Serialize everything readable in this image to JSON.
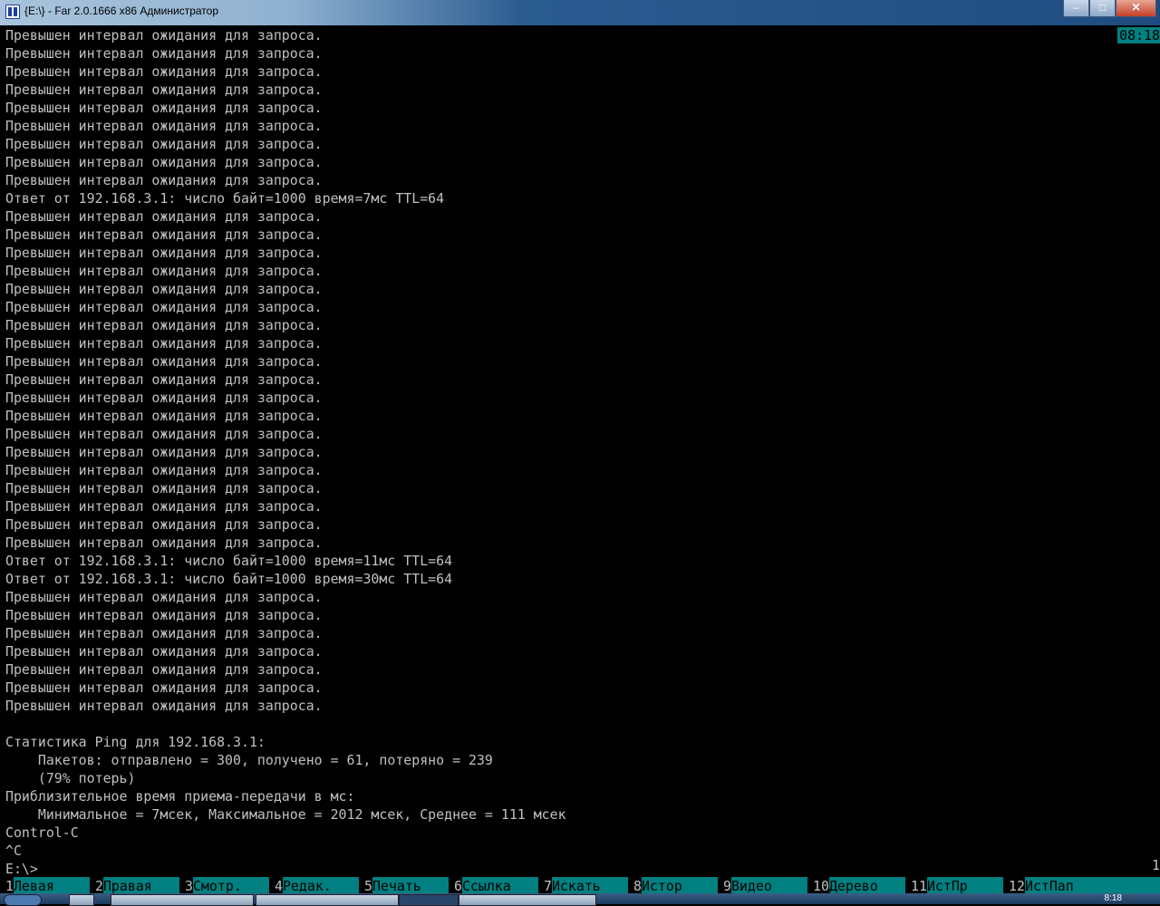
{
  "window": {
    "title": "{E:\\} - Far 2.0.1666 x86 Администратор"
  },
  "clock": "08:18",
  "console_lines": [
    "Превышен интервал ожидания для запроса.",
    "Превышен интервал ожидания для запроса.",
    "Превышен интервал ожидания для запроса.",
    "Превышен интервал ожидания для запроса.",
    "Превышен интервал ожидания для запроса.",
    "Превышен интервал ожидания для запроса.",
    "Превышен интервал ожидания для запроса.",
    "Превышен интервал ожидания для запроса.",
    "Превышен интервал ожидания для запроса.",
    "Ответ от 192.168.3.1: число байт=1000 время=7мс TTL=64",
    "Превышен интервал ожидания для запроса.",
    "Превышен интервал ожидания для запроса.",
    "Превышен интервал ожидания для запроса.",
    "Превышен интервал ожидания для запроса.",
    "Превышен интервал ожидания для запроса.",
    "Превышен интервал ожидания для запроса.",
    "Превышен интервал ожидания для запроса.",
    "Превышен интервал ожидания для запроса.",
    "Превышен интервал ожидания для запроса.",
    "Превышен интервал ожидания для запроса.",
    "Превышен интервал ожидания для запроса.",
    "Превышен интервал ожидания для запроса.",
    "Превышен интервал ожидания для запроса.",
    "Превышен интервал ожидания для запроса.",
    "Превышен интервал ожидания для запроса.",
    "Превышен интервал ожидания для запроса.",
    "Превышен интервал ожидания для запроса.",
    "Превышен интервал ожидания для запроса.",
    "Превышен интервал ожидания для запроса.",
    "Ответ от 192.168.3.1: число байт=1000 время=11мс TTL=64",
    "Ответ от 192.168.3.1: число байт=1000 время=30мс TTL=64",
    "Превышен интервал ожидания для запроса.",
    "Превышен интервал ожидания для запроса.",
    "Превышен интервал ожидания для запроса.",
    "Превышен интервал ожидания для запроса.",
    "Превышен интервал ожидания для запроса.",
    "Превышен интервал ожидания для запроса.",
    "Превышен интервал ожидания для запроса.",
    "",
    "Статистика Ping для 192.168.3.1:",
    "    Пакетов: отправлено = 300, получено = 61, потеряно = 239",
    "    (79% потерь)",
    "Приблизительное время приема-передачи в мс:",
    "    Минимальное = 7мсек, Максимальное = 2012 мсек, Среднее = 111 мсек",
    "Control-C",
    "^C",
    "E:\\>"
  ],
  "right_indicator": "1",
  "keybar": [
    {
      "num": "1",
      "label": "Левая"
    },
    {
      "num": "2",
      "label": "Правая"
    },
    {
      "num": "3",
      "label": "Смотр."
    },
    {
      "num": "4",
      "label": "Редак."
    },
    {
      "num": "5",
      "label": "Печать"
    },
    {
      "num": "6",
      "label": "Ссылка"
    },
    {
      "num": "7",
      "label": "Искать"
    },
    {
      "num": "8",
      "label": "Истор"
    },
    {
      "num": "9",
      "label": "Видео"
    },
    {
      "num": "10",
      "label": "Дерево"
    },
    {
      "num": "11",
      "label": "ИстПр"
    },
    {
      "num": "12",
      "label": "ИстПап"
    }
  ],
  "taskbar": {
    "clock": "8:18"
  }
}
